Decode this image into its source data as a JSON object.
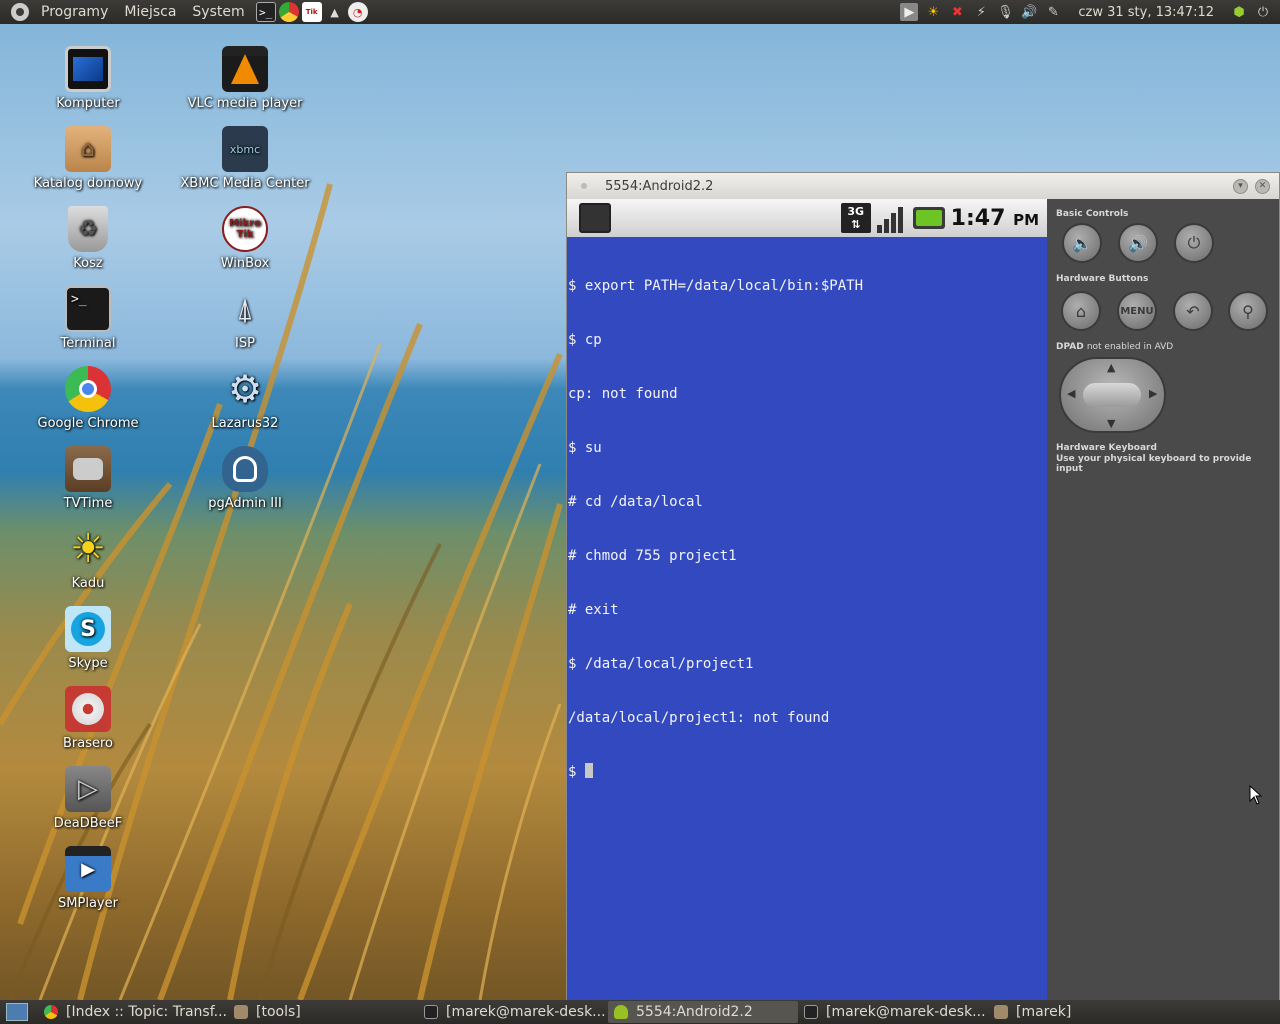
{
  "top_panel": {
    "menus": [
      "Programy",
      "Miejsca",
      "System"
    ],
    "launchers": [
      "terminal-icon",
      "chrome-icon",
      "mikrotik-icon",
      "isp-icon",
      "dial-icon"
    ],
    "tray_icons": [
      "media-icon",
      "weather-icon",
      "dropbox-icon",
      "network-icon",
      "microphone-icon",
      "volume-icon",
      "pencil-icon"
    ],
    "clock": "czw 31 sty, 13:47:12"
  },
  "desktop": {
    "left_column": [
      {
        "label": "Komputer",
        "icon": "monitor-icon"
      },
      {
        "label": "Katalog domowy",
        "icon": "home-folder-icon"
      },
      {
        "label": "Kosz",
        "icon": "trash-icon"
      },
      {
        "label": "Terminal",
        "icon": "terminal-icon"
      },
      {
        "label": "Google Chrome",
        "icon": "chrome-icon"
      },
      {
        "label": "TVTime",
        "icon": "tv-icon"
      },
      {
        "label": "Kadu",
        "icon": "sun-icon"
      },
      {
        "label": "Skype",
        "icon": "skype-icon"
      },
      {
        "label": "Brasero",
        "icon": "disc-icon"
      },
      {
        "label": "DeaDBeeF",
        "icon": "play-icon"
      },
      {
        "label": "SMPlayer",
        "icon": "clapper-icon"
      }
    ],
    "right_column": [
      {
        "label": "VLC media player",
        "icon": "vlc-cone-icon"
      },
      {
        "label": "XBMC Media Center",
        "icon": "xbmc-icon",
        "badge": "xbmc"
      },
      {
        "label": "WinBox",
        "icon": "mikrotik-icon",
        "badge": "Mikro Tik"
      },
      {
        "label": "ISP",
        "icon": "antenna-icon"
      },
      {
        "label": "Lazarus32",
        "icon": "gear-icon"
      },
      {
        "label": "pgAdmin III",
        "icon": "elephant-icon"
      }
    ]
  },
  "window": {
    "title": "5554:Android2.2",
    "statusbar": {
      "network": "3G",
      "time": "1:47",
      "ampm": "PM"
    },
    "terminal_lines": [
      "$ export PATH=/data/local/bin:$PATH",
      "$ cp",
      "cp: not found",
      "$ su",
      "# cd /data/local",
      "# chmod 755 project1",
      "# exit",
      "$ /data/local/project1",
      "/data/local/project1: not found"
    ],
    "prompt": "$ ",
    "controls": {
      "basic_controls": "Basic Controls",
      "hardware_buttons": "Hardware Buttons",
      "dpad": "DPAD",
      "dpad_note": "not enabled in AVD",
      "keyboard_title": "Hardware Keyboard",
      "keyboard_note": "Use your physical keyboard to provide input",
      "menu_label": "MENU"
    }
  },
  "taskbar": [
    {
      "label": "[Index :: Topic: Transf...",
      "icon": "chrome-icon",
      "active": false
    },
    {
      "label": "[tools]",
      "icon": "folder-icon",
      "active": false
    },
    {
      "label": "[marek@marek-desk...",
      "icon": "terminal-icon",
      "active": false
    },
    {
      "label": "5554:Android2.2",
      "icon": "android-icon",
      "active": true
    },
    {
      "label": "[marek@marek-desk...",
      "icon": "terminal-icon",
      "active": false
    },
    {
      "label": "[marek]",
      "icon": "folder-icon",
      "active": false
    }
  ]
}
